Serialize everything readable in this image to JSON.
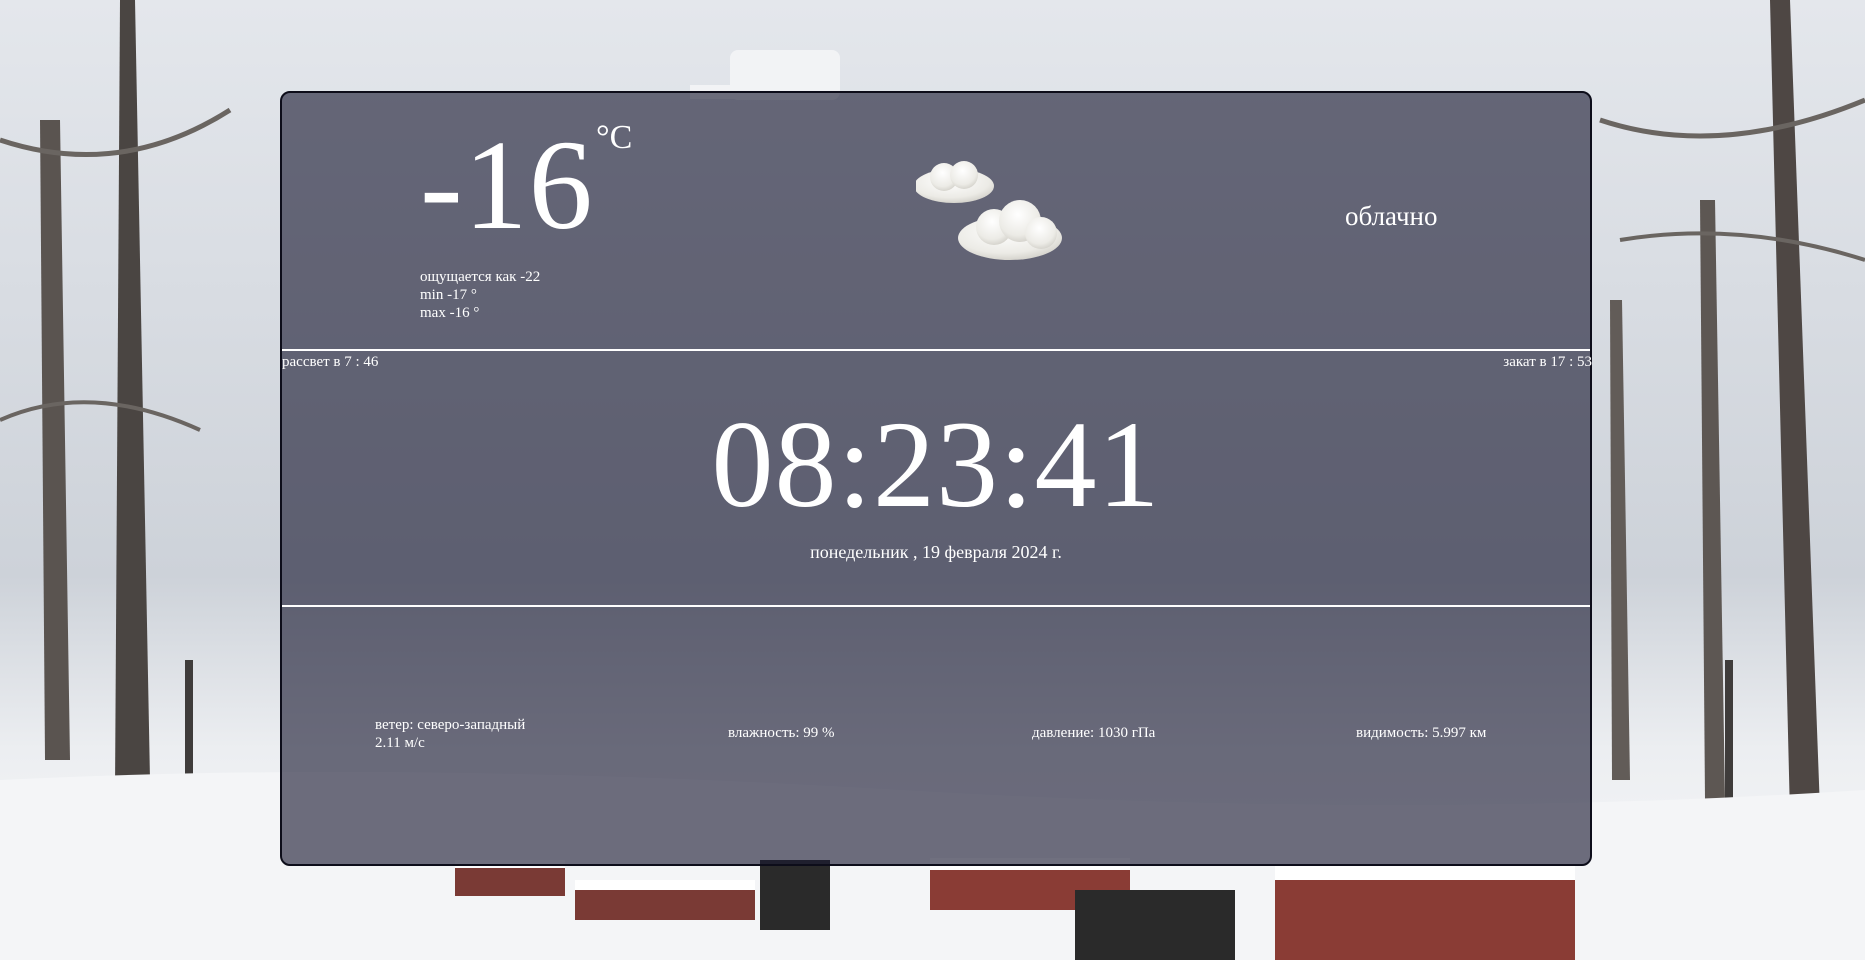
{
  "colors": {
    "panel_background": "#181830",
    "panel_border": "#0d0d1a",
    "text": "#ffffff"
  },
  "weather": {
    "temperature": "-16",
    "unit": "°C",
    "feels_like": "ощущается как -22",
    "min": "min -17 °",
    "max": "max -16 °",
    "condition": "облачно",
    "condition_icon": "cloud-icon"
  },
  "sun": {
    "sunrise": "рассвет в 7 : 46",
    "sunset": "закат в 17 : 53"
  },
  "clock": {
    "time": "08:23:41",
    "date": "понедельник , 19 февраля 2024 г."
  },
  "stats": {
    "wind_line1": "ветер: северо-западный",
    "wind_line2": "2.11 м/с",
    "humidity": "влажность: 99 %",
    "pressure": "давление: 1030 гПа",
    "visibility": "видимость: 5.997 км"
  }
}
